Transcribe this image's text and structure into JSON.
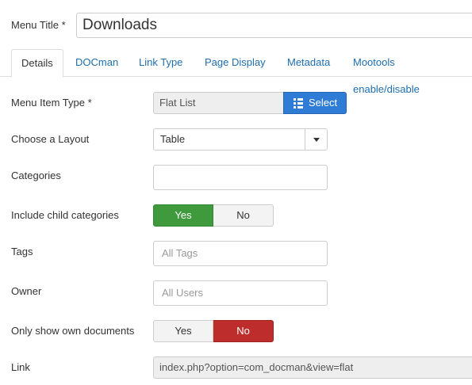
{
  "menu_title": {
    "label": "Menu Title *",
    "value": "Downloads"
  },
  "tabs": [
    {
      "label": "Details",
      "active": true
    },
    {
      "label": "DOCman",
      "active": false
    },
    {
      "label": "Link Type",
      "active": false
    },
    {
      "label": "Page Display",
      "active": false
    },
    {
      "label": "Metadata",
      "active": false
    },
    {
      "label": "Mootools enable/disable",
      "active": false
    }
  ],
  "form": {
    "menu_item_type": {
      "label": "Menu Item Type *",
      "value": "Flat List",
      "button_label": "Select",
      "button_icon": "list-icon"
    },
    "layout": {
      "label": "Choose a Layout",
      "value": "Table"
    },
    "categories": {
      "label": "Categories",
      "value": ""
    },
    "include_child": {
      "label": "Include child categories",
      "yes": "Yes",
      "no": "No",
      "selected": "Yes"
    },
    "tags": {
      "label": "Tags",
      "placeholder": "All Tags"
    },
    "owner": {
      "label": "Owner",
      "placeholder": "All Users"
    },
    "own_documents": {
      "label": "Only show own documents",
      "yes": "Yes",
      "no": "No",
      "selected": "No"
    },
    "link": {
      "label": "Link",
      "value": "index.php?option=com_docman&view=flat"
    }
  },
  "colors": {
    "primary": "#2f7cd6",
    "success": "#3e9a3d",
    "danger": "#bd2d2c",
    "link": "#1f6ead"
  }
}
